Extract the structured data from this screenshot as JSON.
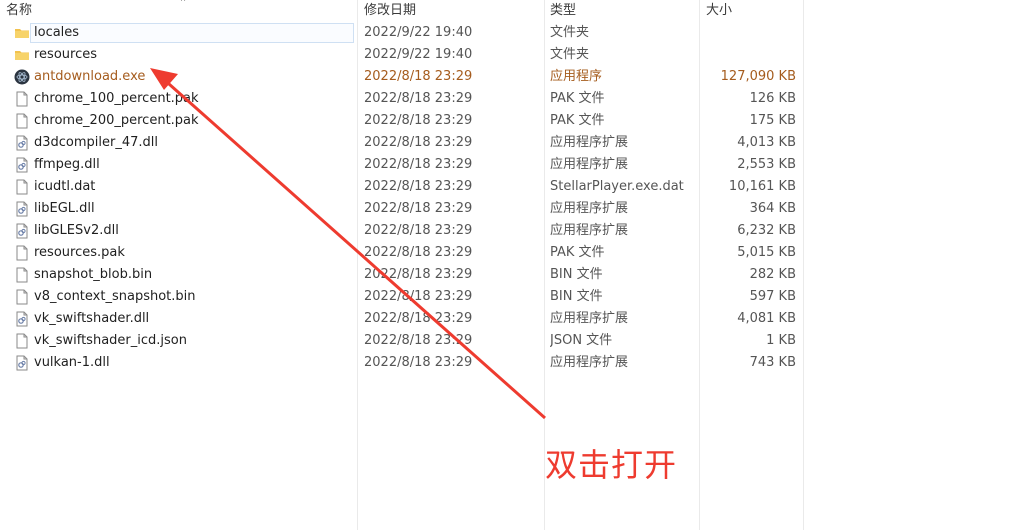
{
  "columns": {
    "name": "名称",
    "date": "修改日期",
    "type": "类型",
    "size": "大小"
  },
  "files": [
    {
      "name": "locales",
      "date": "2022/9/22 19:40",
      "type": "文件夹",
      "size": "",
      "icon": "folder-icon"
    },
    {
      "name": "resources",
      "date": "2022/9/22 19:40",
      "type": "文件夹",
      "size": "",
      "icon": "folder-icon"
    },
    {
      "name": "antdownload.exe",
      "date": "2022/8/18 23:29",
      "type": "应用程序",
      "size": "127,090 KB",
      "icon": "app-exe-icon"
    },
    {
      "name": "chrome_100_percent.pak",
      "date": "2022/8/18 23:29",
      "type": "PAK 文件",
      "size": "126 KB",
      "icon": "file-icon"
    },
    {
      "name": "chrome_200_percent.pak",
      "date": "2022/8/18 23:29",
      "type": "PAK 文件",
      "size": "175 KB",
      "icon": "file-icon"
    },
    {
      "name": "d3dcompiler_47.dll",
      "date": "2022/8/18 23:29",
      "type": "应用程序扩展",
      "size": "4,013 KB",
      "icon": "dll-icon"
    },
    {
      "name": "ffmpeg.dll",
      "date": "2022/8/18 23:29",
      "type": "应用程序扩展",
      "size": "2,553 KB",
      "icon": "dll-icon"
    },
    {
      "name": "icudtl.dat",
      "date": "2022/8/18 23:29",
      "type": "StellarPlayer.exe.dat",
      "size": "10,161 KB",
      "icon": "file-icon"
    },
    {
      "name": "libEGL.dll",
      "date": "2022/8/18 23:29",
      "type": "应用程序扩展",
      "size": "364 KB",
      "icon": "dll-icon"
    },
    {
      "name": "libGLESv2.dll",
      "date": "2022/8/18 23:29",
      "type": "应用程序扩展",
      "size": "6,232 KB",
      "icon": "dll-icon"
    },
    {
      "name": "resources.pak",
      "date": "2022/8/18 23:29",
      "type": "PAK 文件",
      "size": "5,015 KB",
      "icon": "file-icon"
    },
    {
      "name": "snapshot_blob.bin",
      "date": "2022/8/18 23:29",
      "type": "BIN 文件",
      "size": "282 KB",
      "icon": "file-icon"
    },
    {
      "name": "v8_context_snapshot.bin",
      "date": "2022/8/18 23:29",
      "type": "BIN 文件",
      "size": "597 KB",
      "icon": "file-icon"
    },
    {
      "name": "vk_swiftshader.dll",
      "date": "2022/8/18 23:29",
      "type": "应用程序扩展",
      "size": "4,081 KB",
      "icon": "dll-icon"
    },
    {
      "name": "vk_swiftshader_icd.json",
      "date": "2022/8/18 23:29",
      "type": "JSON 文件",
      "size": "1 KB",
      "icon": "file-icon"
    },
    {
      "name": "vulkan-1.dll",
      "date": "2022/8/18 23:29",
      "type": "应用程序扩展",
      "size": "743 KB",
      "icon": "dll-icon"
    }
  ],
  "annotation": {
    "text": "双击打开",
    "color": "#ee3b2f"
  },
  "colors": {
    "exe_text": "#a55c1e",
    "folder": "#f2c24e",
    "selection_border": "#cfe0f3"
  }
}
